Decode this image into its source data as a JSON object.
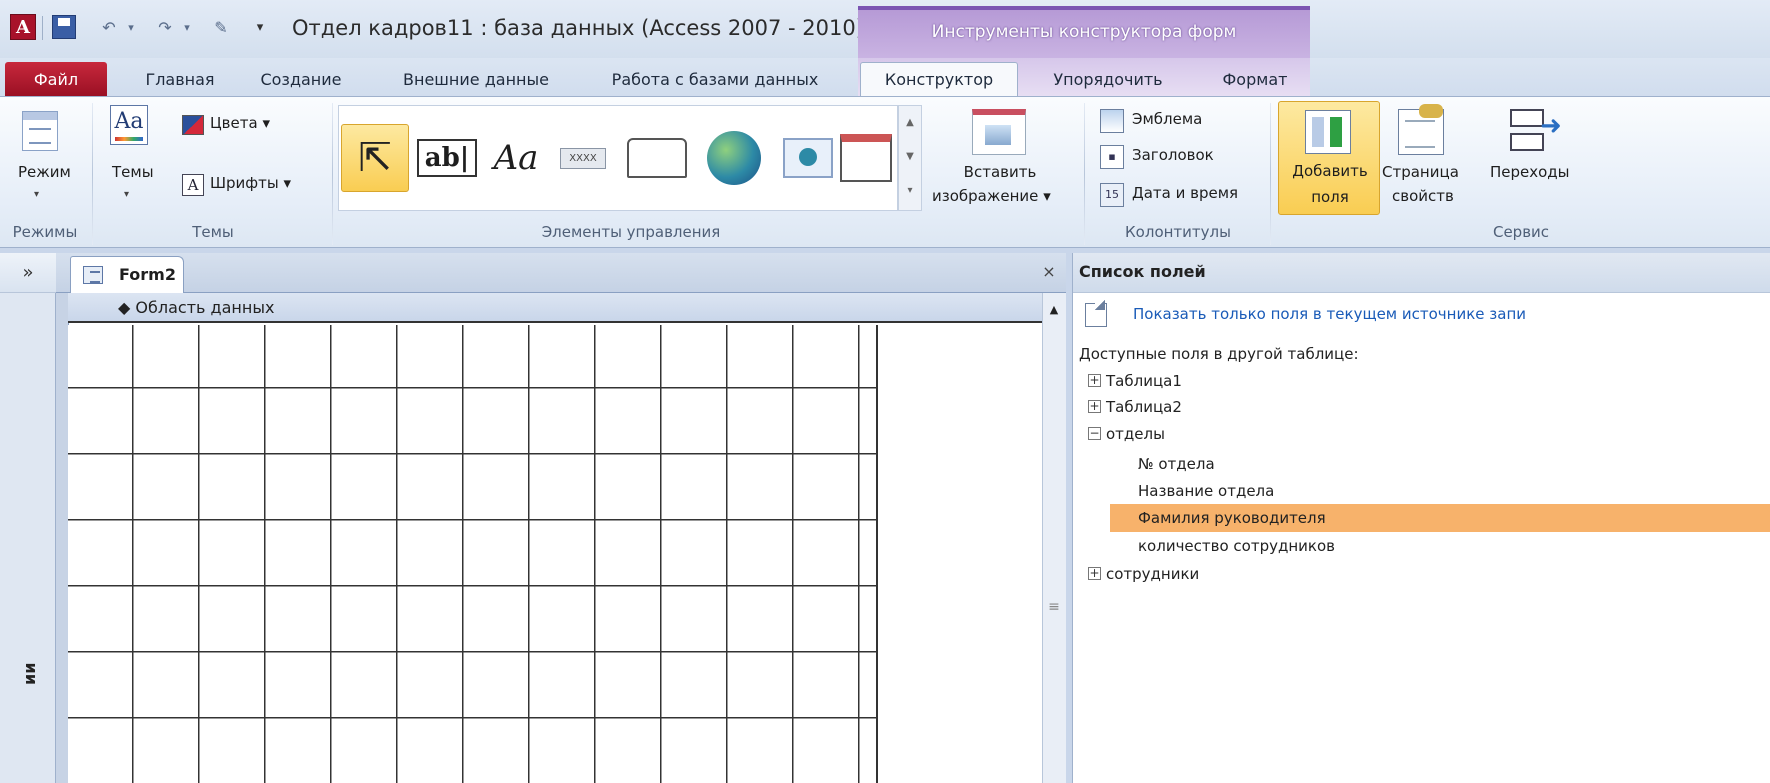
{
  "titlebar": {
    "app_icon": "access-app-icon",
    "window_title": "Отдел кадров11 : база данных (Access 2007 - 2010)",
    "context_header": "Инструменты конструктора форм"
  },
  "quick_access": {
    "icons": [
      "save-icon",
      "undo-icon",
      "redo-icon",
      "edit-icon",
      "customize-icon"
    ]
  },
  "tabs": {
    "file": "Файл",
    "home": "Главная",
    "create": "Создание",
    "external": "Внешние данные",
    "database": "Работа с базами данных",
    "design": "Конструктор",
    "arrange": "Упорядочить",
    "format": "Формат",
    "active": "Конструктор"
  },
  "ribbon": {
    "groups": {
      "views": "Режимы",
      "themes": "Темы",
      "controls": "Элементы управления",
      "header_footer": "Колонтитулы",
      "tools": "Сервис"
    },
    "mode_label": "Режим",
    "themes_label": "Темы",
    "colors_label": "Цвета",
    "fonts_label": "Шрифты",
    "textbox_glyph": "ab|",
    "label_glyph": "Aa",
    "button_glyph": "XXXX",
    "insert_image_line1": "Вставить",
    "insert_image_line2": "изображение",
    "logo_label": "Эмблема",
    "title_label": "Заголовок",
    "datetime_label": "Дата и время",
    "add_fields_line1": "Добавить",
    "add_fields_line2": "поля",
    "property_sheet_line1": "Страница",
    "property_sheet_line2": "свойств",
    "tab_order_label": "Переходы"
  },
  "nav_pane": {
    "toggle": "»",
    "vertical_text": "ии"
  },
  "document": {
    "tab_label": "Form2",
    "close": "×",
    "section_label": "Область данных"
  },
  "field_list": {
    "title": "Список полей",
    "filter_link": "Показать только поля в текущем источнике запи",
    "available_label": "Доступные поля в другой таблице:",
    "tables": [
      {
        "name": "Таблица1",
        "expanded": false
      },
      {
        "name": "Таблица2",
        "expanded": false
      },
      {
        "name": "отделы",
        "expanded": true,
        "fields": [
          "№ отдела",
          "Название отдела",
          "Фамилия руководителя",
          "количество сотрудников"
        ],
        "selected_field": "Фамилия руководителя"
      },
      {
        "name": "сотрудники",
        "expanded": false
      }
    ],
    "expand_glyph": "+",
    "collapse_glyph": "−"
  },
  "colors": {
    "file_tab": "#b0182f",
    "context_accent": "#7b54b3",
    "selected_field": "#f7b26b",
    "link": "#1a5bb8",
    "active_button": "#f9cd52"
  }
}
